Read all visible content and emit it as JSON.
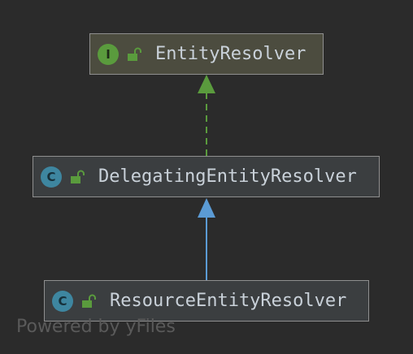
{
  "diagram": {
    "nodes": [
      {
        "id": "entity-resolver",
        "kind": "interface",
        "badge": "I",
        "name": "EntityResolver"
      },
      {
        "id": "delegating-entity-resolver",
        "kind": "class",
        "badge": "C",
        "name": "DelegatingEntityResolver"
      },
      {
        "id": "resource-entity-resolver",
        "kind": "class",
        "badge": "C",
        "name": "ResourceEntityResolver"
      }
    ],
    "edges": [
      {
        "from": "delegating-entity-resolver",
        "to": "entity-resolver",
        "type": "implements",
        "style": "dashed",
        "color": "#5a9b3d"
      },
      {
        "from": "resource-entity-resolver",
        "to": "delegating-entity-resolver",
        "type": "extends",
        "style": "solid",
        "color": "#5b9bd5"
      }
    ],
    "colors": {
      "background": "#2b2b2b",
      "interface_fill": "#4c4c3f",
      "class_fill": "#3b3e40",
      "border": "#8f8f8f",
      "text": "#c9d1d9",
      "interface_badge": "#5a9b3d",
      "class_badge": "#3e86a0",
      "lock_icon": "#5a9b3d"
    }
  },
  "watermark": "Powered by yFiles"
}
